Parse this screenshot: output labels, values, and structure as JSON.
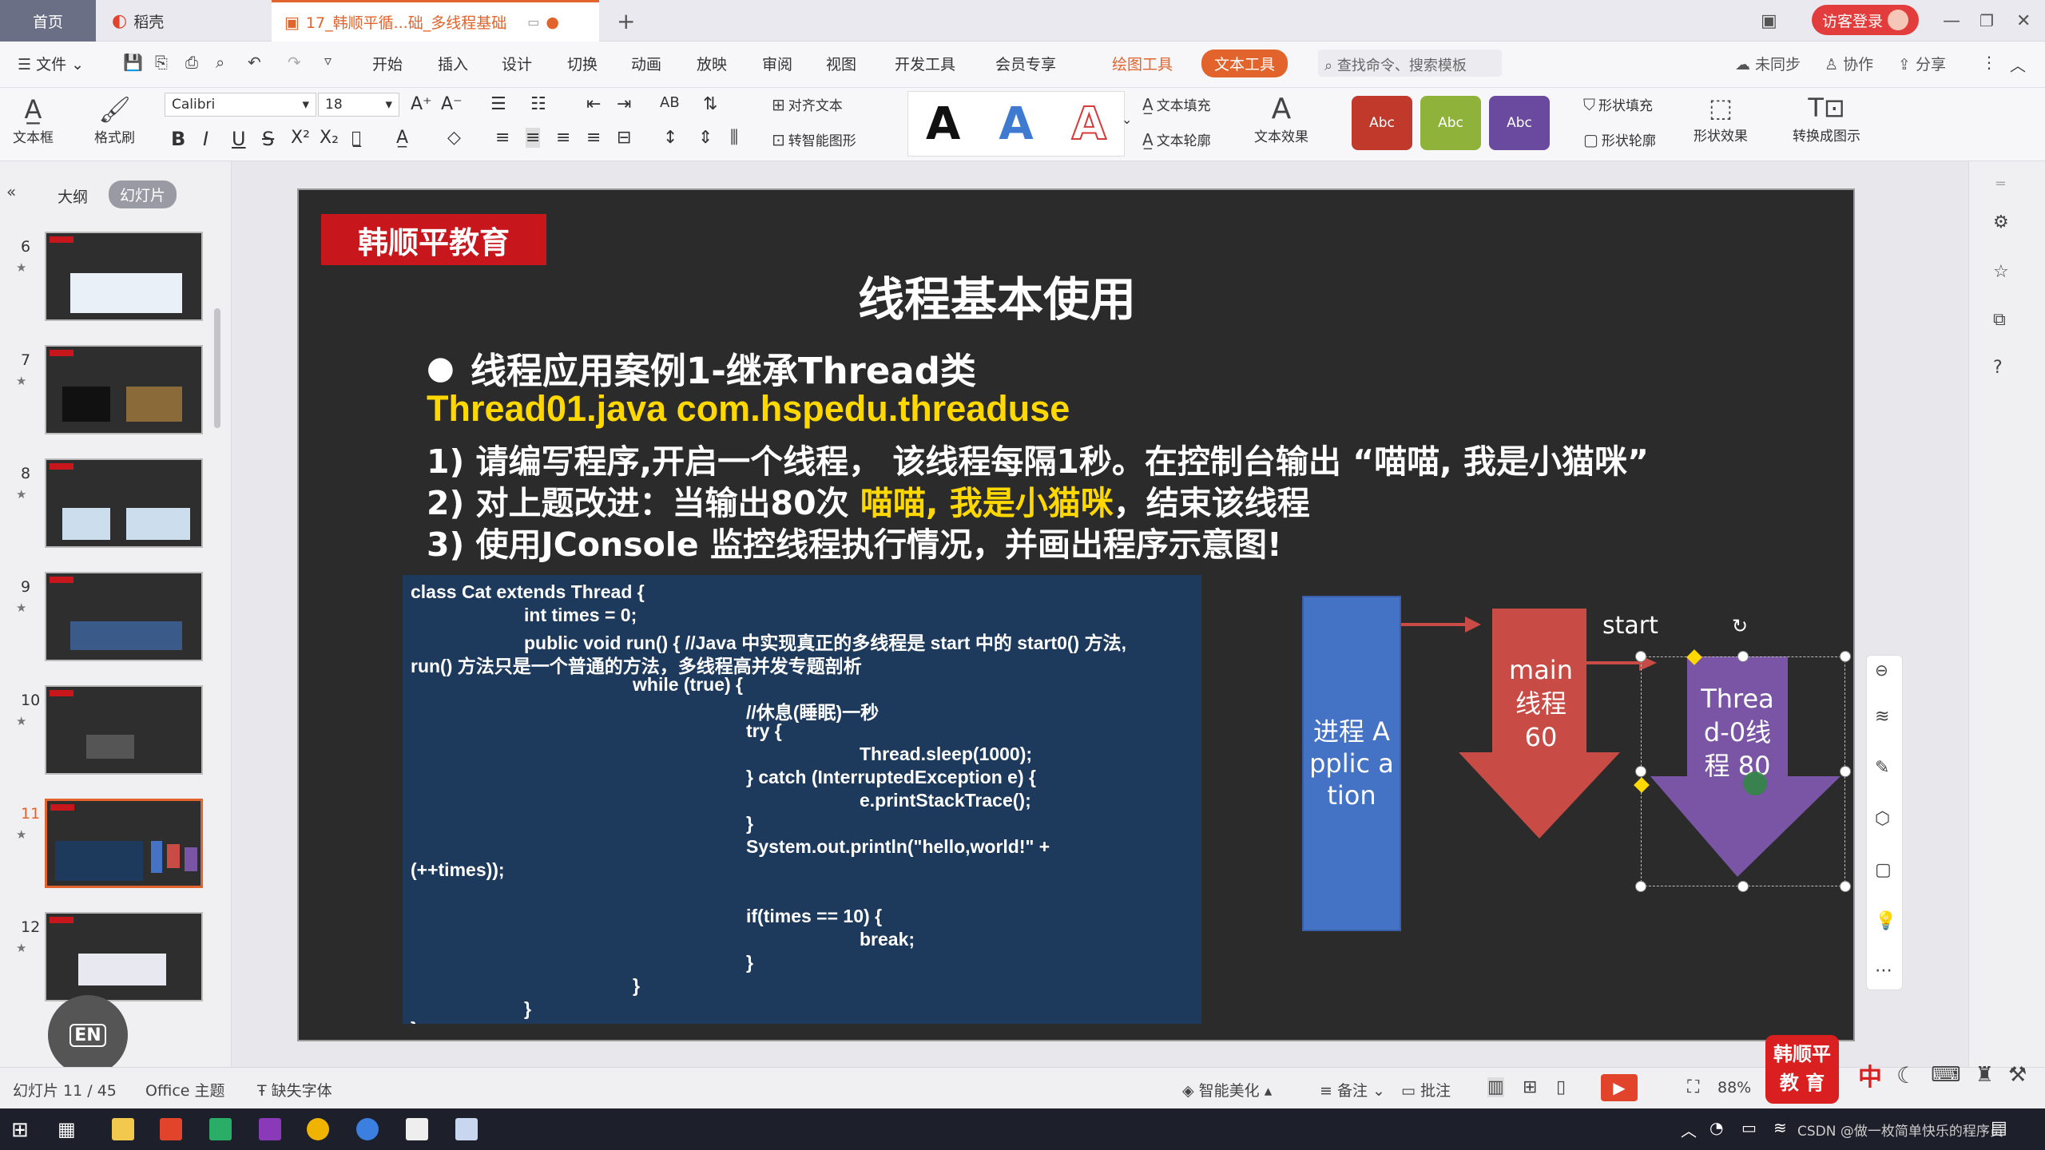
{
  "tabs": {
    "home": "首页",
    "daoke": "稻壳",
    "doc": "17_韩顺平循...础_多线程基础",
    "new": "+"
  },
  "account": {
    "login": "访客登录"
  },
  "menu": {
    "file": "文件",
    "items": [
      "开始",
      "插入",
      "设计",
      "切换",
      "动画",
      "放映",
      "审阅",
      "视图",
      "开发工具",
      "会员专享"
    ],
    "draw_tools": "绘图工具",
    "text_tools": "文本工具",
    "search": "查找命令、搜索模板",
    "unsync": "未同步",
    "collab": "协作",
    "share": "分享"
  },
  "toolbar": {
    "textbox": "文本框",
    "format_painter": "格式刷",
    "font": "Calibri",
    "size": "18",
    "align_text": "对齐文本",
    "to_smartart": "转智能图形",
    "text_fill": "文本填充",
    "text_outline": "文本轮廓",
    "text_effect": "文本效果",
    "shape_fill": "形状填充",
    "shape_outline": "形状轮廓",
    "shape_effect": "形状效果",
    "convert_diagram": "转换成图示",
    "style_letter": "A",
    "abc": "Abc",
    "colors": {
      "red": "#c0392b",
      "green": "#8fb23a",
      "purple": "#6a4a9e"
    }
  },
  "panel": {
    "outline": "大纲",
    "slides": "幻灯片",
    "numbers": [
      "6",
      "7",
      "8",
      "9",
      "10",
      "11",
      "12"
    ]
  },
  "slide": {
    "brand": "韩顺平教育",
    "title": "线程基本使用",
    "bullet": "线程应用案例1-继承Thread类",
    "file_line": "Thread01.java com.hspedu.threaduse",
    "req1": "1) 请编写程序,开启一个线程， 该线程每隔1秒。在控制台输出 “喵喵, 我是小猫咪”",
    "req2_prefix": "2) 对上题改进：当输出80次 ",
    "req2_highlight": "喵喵, 我是小猫咪",
    "req2_suffix": "，结束该线程",
    "req3": "3) 使用JConsole 监控线程执行情况，并画出程序示意图!",
    "code": [
      "class Cat extends Thread {",
      "int times = 0;",
      "public void run() { //Java 中实现真正的多线程是 start 中的 start0() 方法,",
      "run() 方法只是一个普通的方法，多线程高并发专题剖析",
      "while (true) {",
      "//休息(睡眠)一秒",
      "try {",
      "Thread.sleep(1000);",
      "} catch (InterruptedException e) {",
      "e.printStackTrace();",
      "}",
      "System.out.println(\"hello,world!\" +",
      "(++times));",
      "if(times == 10) {",
      "break;",
      "}",
      "}",
      "}",
      "}"
    ],
    "process_box": "进程 Applic ation",
    "main_arrow": "main 线程 60",
    "start_label": "start",
    "thread0": "Threa d-0线 程 80",
    "colors": {
      "brand_bg": "#c8161d",
      "code_bg": "#1d3a5c",
      "process": "#4472c4",
      "main": "#c84b45",
      "thread0": "#7a55a6",
      "yellow": "#ffd800"
    }
  },
  "status": {
    "slide_count": "幻灯片 11 / 45",
    "theme": "Office 主题",
    "missing_font": "缺失字体",
    "beautify": "智能美化",
    "notes": "备注",
    "comment": "批注",
    "zoom": "88%"
  },
  "floating": {
    "badge": "韩顺平 教 育",
    "ime": "中",
    "en": "EN"
  },
  "taskbar": {
    "tray_text": "CSDN @做一枚简单快乐的程序员"
  }
}
